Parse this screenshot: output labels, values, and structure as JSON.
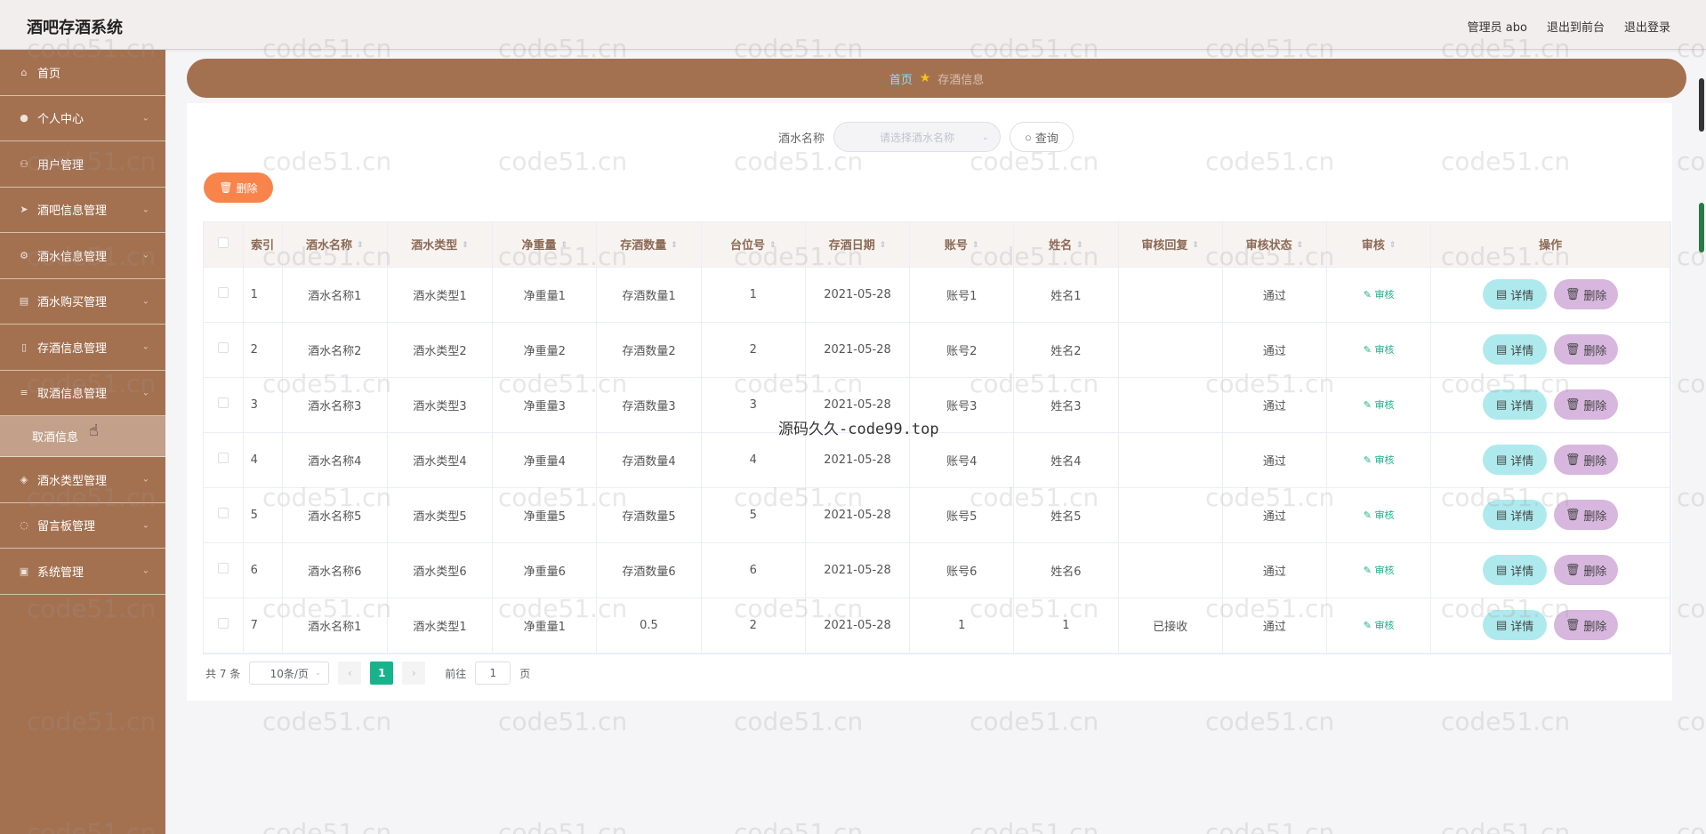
{
  "app": {
    "title": "酒吧存酒系统",
    "user_label": "管理员 abo",
    "front_link": "退出到前台",
    "logout_link": "退出登录"
  },
  "sidebar": {
    "items": [
      {
        "label": "首页",
        "icon": "home-icon",
        "has_sub": false
      },
      {
        "label": "个人中心",
        "icon": "user-icon",
        "has_sub": true
      },
      {
        "label": "用户管理",
        "icon": "users-icon",
        "has_sub": false
      },
      {
        "label": "酒吧信息管理",
        "icon": "send-icon",
        "has_sub": true
      },
      {
        "label": "酒水信息管理",
        "icon": "gear-icon",
        "has_sub": true
      },
      {
        "label": "酒水购买管理",
        "icon": "cart-icon",
        "has_sub": true
      },
      {
        "label": "存酒信息管理",
        "icon": "bottle-icon",
        "has_sub": true
      },
      {
        "label": "取酒信息管理",
        "icon": "list-icon",
        "has_sub": true
      },
      {
        "label": "酒水类型管理",
        "icon": "tag-icon",
        "has_sub": true
      },
      {
        "label": "留言板管理",
        "icon": "message-icon",
        "has_sub": true
      },
      {
        "label": "系统管理",
        "icon": "system-icon",
        "has_sub": true
      }
    ],
    "active_sub": "取酒信息"
  },
  "breadcrumb": {
    "home": "首页",
    "current": "存酒信息"
  },
  "search": {
    "label": "酒水名称",
    "placeholder": "请选择酒水名称",
    "button": "查询"
  },
  "bulk_delete": "删除",
  "table": {
    "columns": [
      "索引",
      "酒水名称",
      "酒水类型",
      "净重量",
      "存酒数量",
      "台位号",
      "存酒日期",
      "账号",
      "姓名",
      "审核回复",
      "审核状态",
      "审核",
      "操作"
    ],
    "rows": [
      {
        "idx": "1",
        "name": "酒水名称1",
        "type": "酒水类型1",
        "weight": "净重量1",
        "qty": "存酒数量1",
        "table": "1",
        "date": "2021-05-28",
        "account": "账号1",
        "person": "姓名1",
        "reply": "",
        "status": "通过"
      },
      {
        "idx": "2",
        "name": "酒水名称2",
        "type": "酒水类型2",
        "weight": "净重量2",
        "qty": "存酒数量2",
        "table": "2",
        "date": "2021-05-28",
        "account": "账号2",
        "person": "姓名2",
        "reply": "",
        "status": "通过"
      },
      {
        "idx": "3",
        "name": "酒水名称3",
        "type": "酒水类型3",
        "weight": "净重量3",
        "qty": "存酒数量3",
        "table": "3",
        "date": "2021-05-28",
        "account": "账号3",
        "person": "姓名3",
        "reply": "",
        "status": "通过"
      },
      {
        "idx": "4",
        "name": "酒水名称4",
        "type": "酒水类型4",
        "weight": "净重量4",
        "qty": "存酒数量4",
        "table": "4",
        "date": "2021-05-28",
        "account": "账号4",
        "person": "姓名4",
        "reply": "",
        "status": "通过"
      },
      {
        "idx": "5",
        "name": "酒水名称5",
        "type": "酒水类型5",
        "weight": "净重量5",
        "qty": "存酒数量5",
        "table": "5",
        "date": "2021-05-28",
        "account": "账号5",
        "person": "姓名5",
        "reply": "",
        "status": "通过"
      },
      {
        "idx": "6",
        "name": "酒水名称6",
        "type": "酒水类型6",
        "weight": "净重量6",
        "qty": "存酒数量6",
        "table": "6",
        "date": "2021-05-28",
        "account": "账号6",
        "person": "姓名6",
        "reply": "",
        "status": "通过"
      },
      {
        "idx": "7",
        "name": "酒水名称1",
        "type": "酒水类型1",
        "weight": "净重量1",
        "qty": "0.5",
        "table": "2",
        "date": "2021-05-28",
        "account": "1",
        "person": "1",
        "reply": "已接收",
        "status": "通过"
      }
    ],
    "audit_label": "审核",
    "detail_label": "详情",
    "delete_label": "删除"
  },
  "pagination": {
    "total": "共 7 条",
    "page_size": "10条/页",
    "current_page": "1",
    "goto_prefix": "前往",
    "goto_value": "1",
    "goto_suffix": "页"
  },
  "watermarks": {
    "site": "code51.cn",
    "center": "源码久久-code99.top"
  },
  "colors": {
    "sidebar": "#a47150",
    "accent_green": "#18b38c",
    "delete_orange": "#f8844c",
    "detail_cyan": "#aeeaed",
    "row_delete_purple": "#d7b7de"
  }
}
